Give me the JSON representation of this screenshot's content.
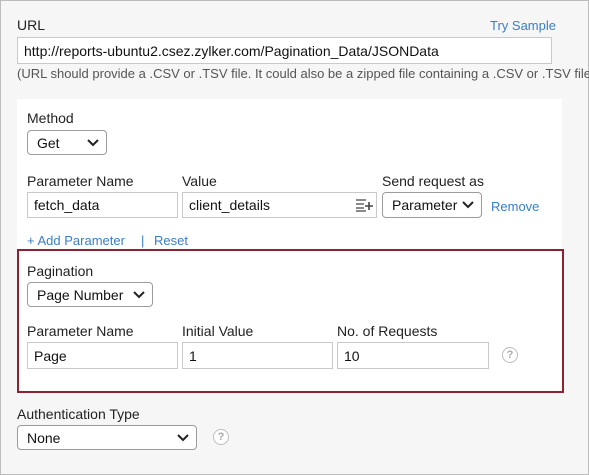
{
  "url_section": {
    "label": "URL",
    "try_sample": "Try Sample",
    "value": "http://reports-ubuntu2.csez.zylker.com/Pagination_Data/JSONData",
    "hint": "(URL should provide a .CSV or .TSV file. It could also be a zipped file containing a .CSV or .TSV file)"
  },
  "method": {
    "label": "Method",
    "selected": "Get"
  },
  "parameters": {
    "name_header": "Parameter Name",
    "value_header": "Value",
    "send_header": "Send request as",
    "row": {
      "name": "fetch_data",
      "value": "client_details",
      "send_as": "Parameter",
      "remove": "Remove"
    },
    "add_parameter": "+ Add Parameter",
    "separator": "|",
    "reset": "Reset"
  },
  "pagination": {
    "label": "Pagination",
    "selected": "Page Number",
    "name_header": "Parameter Name",
    "initial_header": "Initial Value",
    "requests_header": "No. of Requests",
    "name_value": "Page",
    "initial_value": "1",
    "requests_value": "10",
    "help_icon": "question-circle-icon"
  },
  "authentication": {
    "label": "Authentication Type",
    "selected": "None",
    "help_icon": "question-circle-icon"
  },
  "colors": {
    "link": "#3a7ec6",
    "highlight_border": "#8b2232"
  }
}
